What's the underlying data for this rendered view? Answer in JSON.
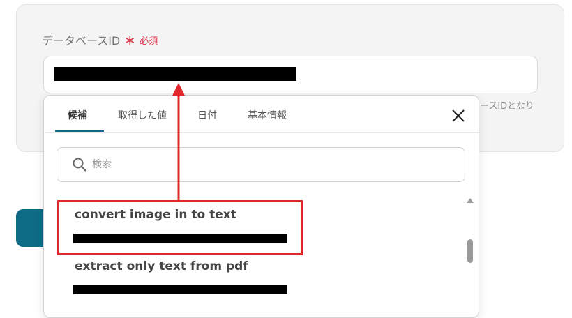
{
  "field": {
    "label": "データベースID",
    "required_star": "＊",
    "required_text": "必須",
    "hint_fragment": "ースIDとなり"
  },
  "picker": {
    "tabs": [
      {
        "label": "候補",
        "active": true
      },
      {
        "label": "取得した値",
        "active": false
      },
      {
        "label": "日付",
        "active": false
      },
      {
        "label": "基本情報",
        "active": false
      }
    ],
    "search_placeholder": "検索",
    "items": [
      {
        "title": "convert image in to text",
        "highlighted": true
      },
      {
        "title": "extract only text from pdf",
        "highlighted": false
      }
    ]
  },
  "colors": {
    "accent": "#0e6b86",
    "required": "#e0354b",
    "annotation": "#e0272b"
  },
  "icons": {
    "close": "close-icon",
    "search": "search-icon",
    "scroll_up": "scroll-up-arrow-icon"
  }
}
